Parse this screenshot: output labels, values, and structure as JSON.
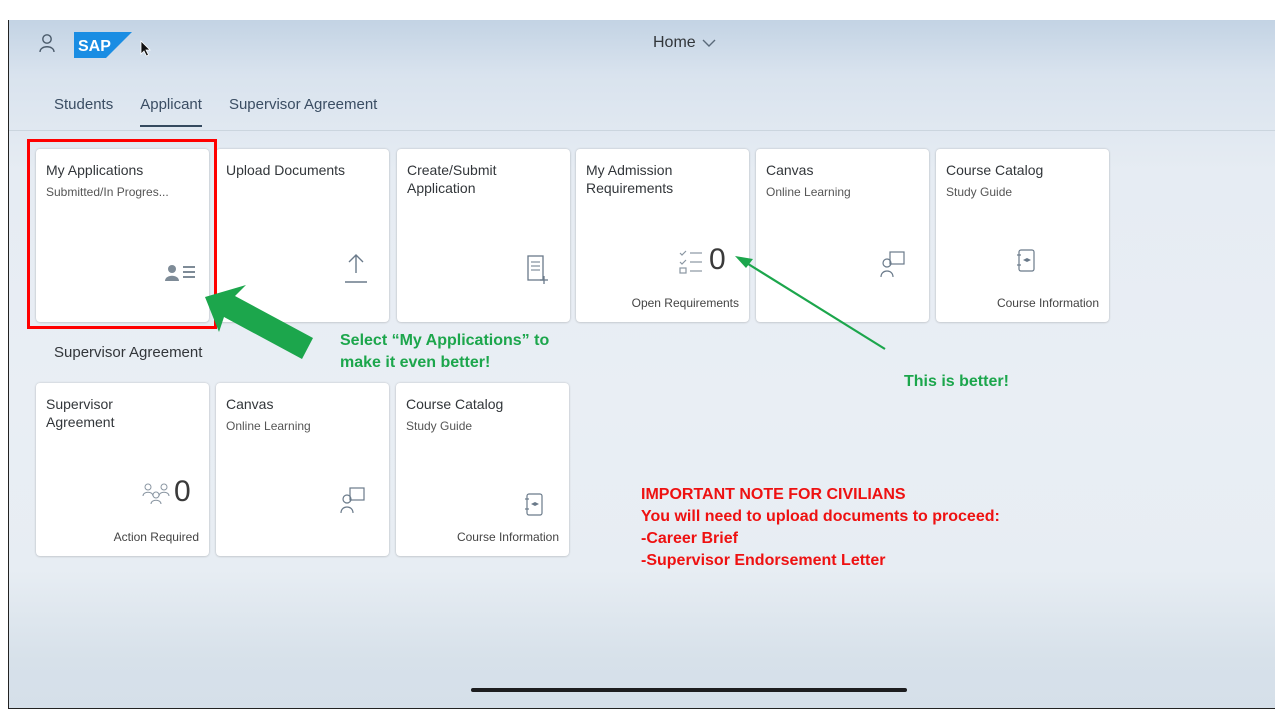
{
  "shell": {
    "title": "Home",
    "logo_text": "SAP"
  },
  "tabs": [
    {
      "label": "Students"
    },
    {
      "label": "Applicant"
    },
    {
      "label": "Supervisor Agreement"
    }
  ],
  "applicant_tiles": [
    {
      "title": "My Applications",
      "subtitle": "Submitted/In Progres...",
      "icon": "applicant-icon"
    },
    {
      "title": "Upload Documents",
      "icon": "upload-icon"
    },
    {
      "title": "Create/Submit Application",
      "icon": "form-icon"
    },
    {
      "title": "My Admission Requirements",
      "number": "0",
      "footer": "Open Requirements",
      "icon": "checklist-icon"
    },
    {
      "title": "Canvas",
      "subtitle": "Online Learning",
      "icon": "learning-icon"
    },
    {
      "title": "Course Catalog",
      "subtitle": "Study Guide",
      "footer": "Course Information",
      "icon": "catalog-book-icon"
    }
  ],
  "supervisor_section": {
    "title": "Supervisor Agreement",
    "tiles": [
      {
        "title": "Supervisor Agreement",
        "number": "0",
        "footer": "Action Required",
        "icon": "group-icon"
      },
      {
        "title": "Canvas",
        "subtitle": "Online Learning",
        "icon": "learning-icon"
      },
      {
        "title": "Course Catalog",
        "subtitle": "Study Guide",
        "footer": "Course Information",
        "icon": "catalog-book-icon"
      }
    ]
  },
  "annotations": {
    "select_line1": "Select “My Applications” to",
    "select_line2": "make it even better!",
    "better": "This is better!",
    "note_heading": "IMPORTANT NOTE FOR CIVILIANS",
    "note_line": "You will need to upload documents to proceed:",
    "note_item1": "-Career Brief",
    "note_item2": "-Supervisor Endorsement Letter"
  },
  "colors": {
    "highlight_red": "#ff0000",
    "callout_green": "#1ca64c",
    "note_red": "#ee1111",
    "sap_blue": "#1a8de3"
  }
}
